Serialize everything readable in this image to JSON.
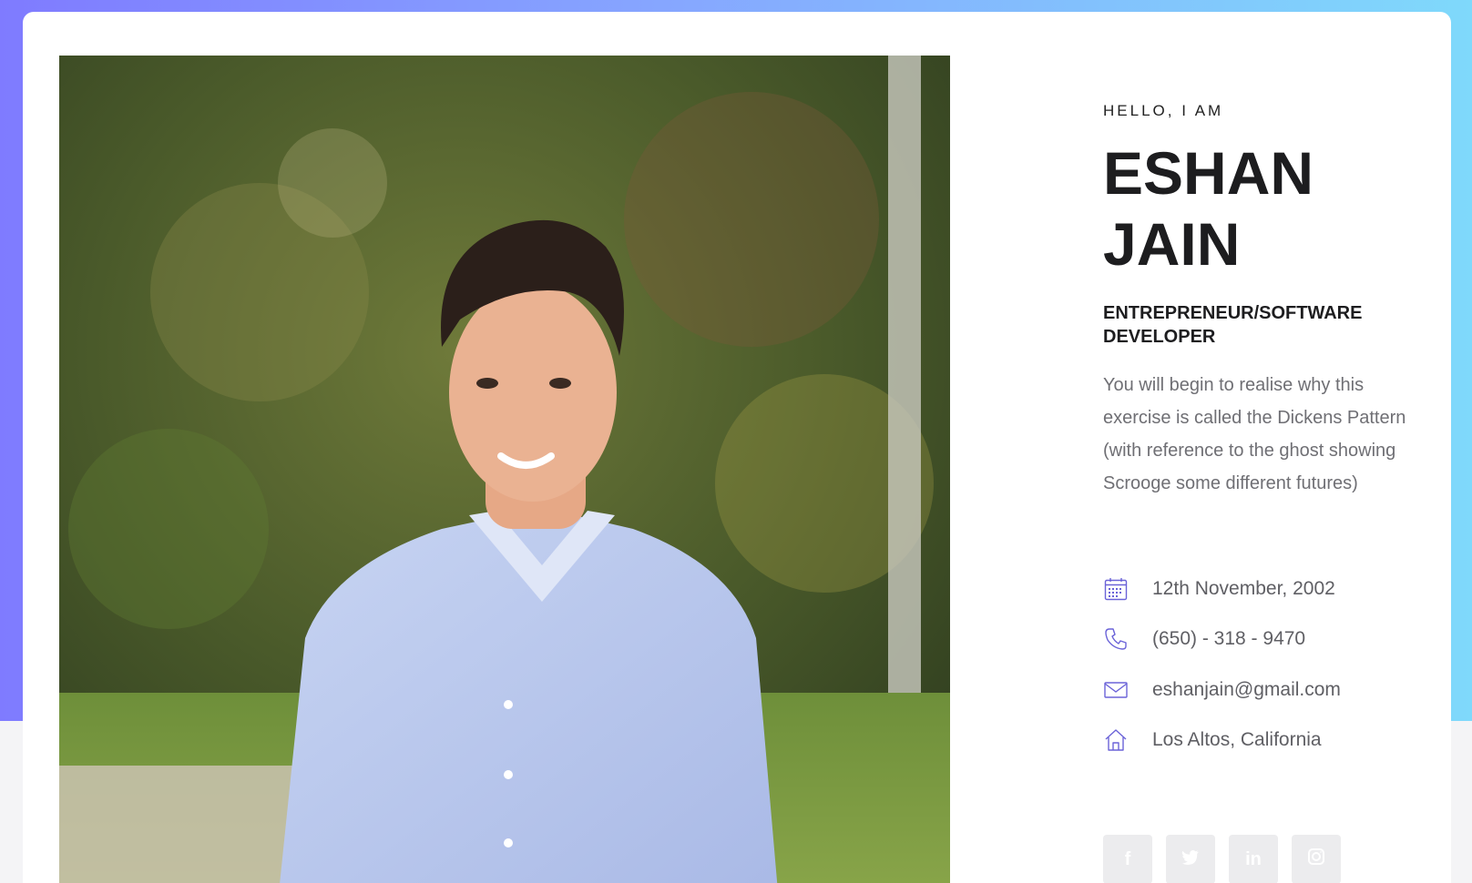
{
  "hero": {
    "greeting": "HELLO, I AM",
    "name_line1": "ESHAN",
    "name_line2": "JAIN",
    "role": "ENTREPRENEUR/SOFTWARE DEVELOPER",
    "bio": "You will begin to realise why this exercise is called the Dickens Pattern (with reference to the ghost showing Scrooge some different futures)"
  },
  "details": [
    {
      "icon": "calendar-icon",
      "text": "12th November, 2002"
    },
    {
      "icon": "phone-icon",
      "text": "(650) - 318 - 9470"
    },
    {
      "icon": "mail-icon",
      "text": "eshanjain@gmail.com"
    },
    {
      "icon": "home-icon",
      "text": "Los Altos, California"
    }
  ],
  "social": [
    {
      "icon": "facebook-icon",
      "glyph": "f"
    },
    {
      "icon": "twitter-icon",
      "glyph": ""
    },
    {
      "icon": "linkedin-icon",
      "glyph": "in"
    },
    {
      "icon": "instagram-icon",
      "glyph": ""
    }
  ],
  "colors": {
    "gradient_start": "#7f7bff",
    "gradient_end": "#7fd9fb",
    "icon_accent": "#6b63d8",
    "heading": "#1d1d1f",
    "body_text": "#6f6f74"
  }
}
